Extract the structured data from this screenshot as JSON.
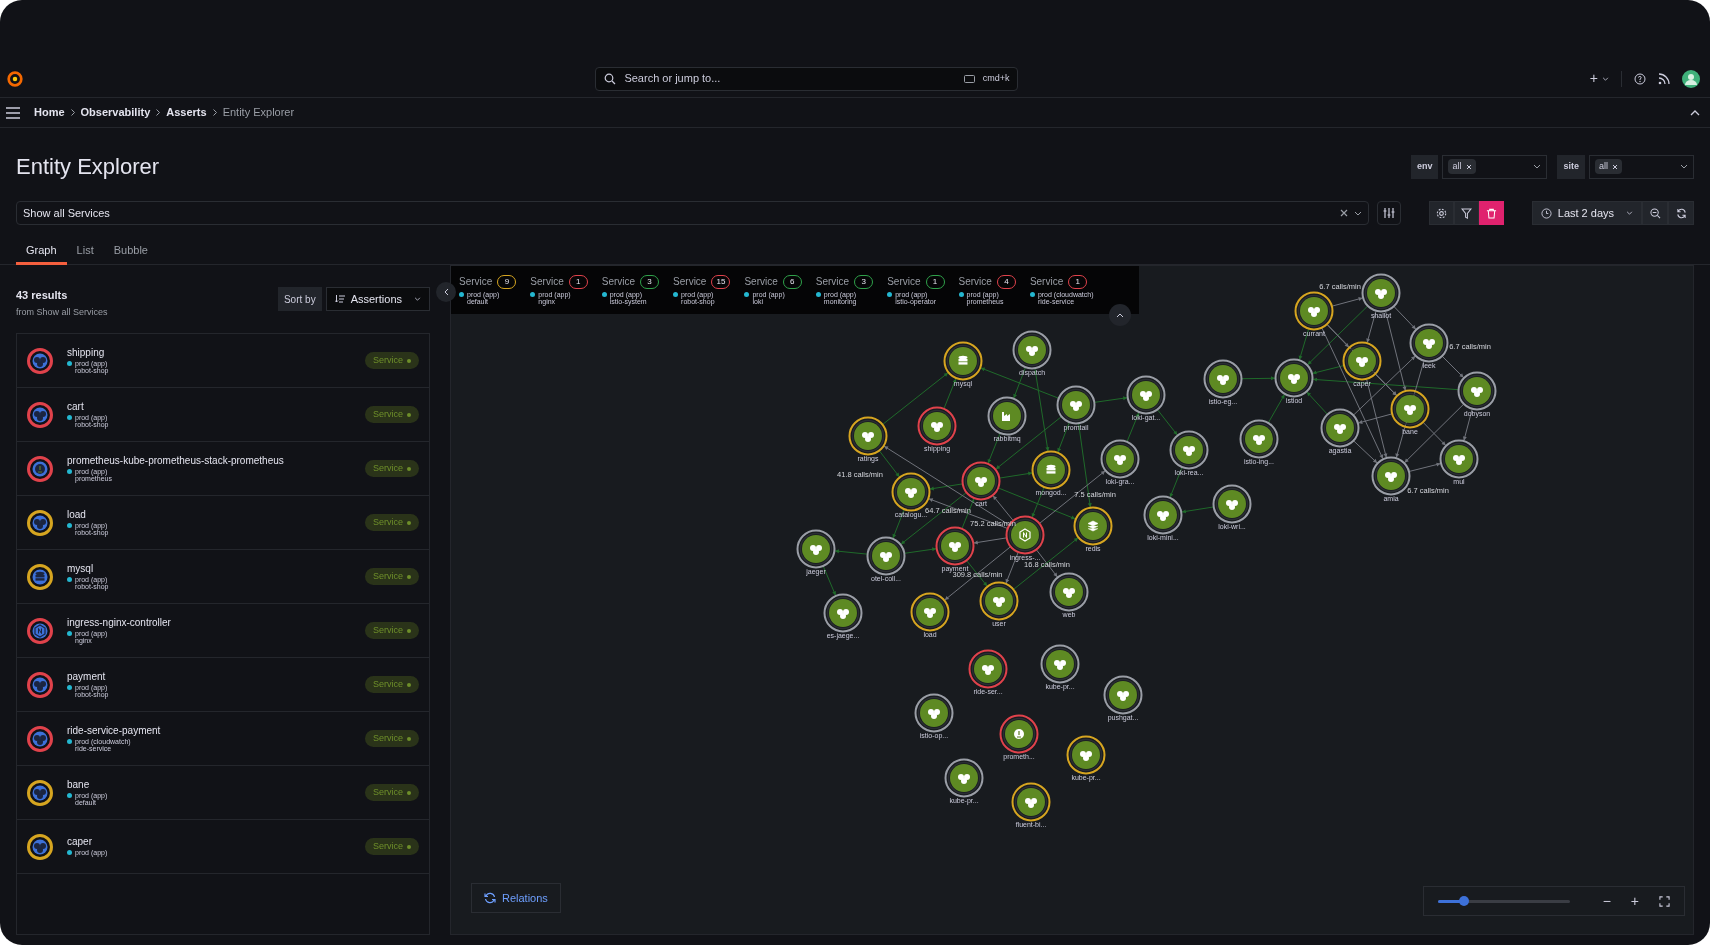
{
  "top_bar": {
    "search": {
      "placeholder": "Search or jump to...",
      "shortcut": "cmd+k"
    },
    "add_label": "+"
  },
  "breadcrumbs": [
    {
      "label": "Home",
      "current": false
    },
    {
      "label": "Observability",
      "current": false
    },
    {
      "label": "Asserts",
      "current": false
    },
    {
      "label": "Entity Explorer",
      "current": true
    }
  ],
  "page_title": "Entity Explorer",
  "variables": [
    {
      "label": "env",
      "value": "all"
    },
    {
      "label": "site",
      "value": "all"
    }
  ],
  "query": {
    "value": "Show all Services"
  },
  "time_range": "Last 2 days",
  "tabs": [
    {
      "label": "Graph",
      "selected": true
    },
    {
      "label": "List",
      "selected": false
    },
    {
      "label": "Bubble",
      "selected": false
    }
  ],
  "results": {
    "count": "43 results",
    "source": "from Show all Services",
    "sort_label": "Sort by",
    "sort_value": "Assertions"
  },
  "entities": [
    {
      "name": "shipping",
      "env": "prod (app)",
      "namespace": "robot-shop",
      "badge": "Service",
      "kind": "service",
      "color": "#e0424b"
    },
    {
      "name": "cart",
      "env": "prod (app)",
      "namespace": "robot-shop",
      "badge": "Service",
      "kind": "service",
      "color": "#e0424b"
    },
    {
      "name": "prometheus-kube-prometheus-stack-prometheus",
      "env": "prod (app)",
      "namespace": "prometheus",
      "badge": "Service",
      "kind": "prometheus",
      "color": "#e0424b"
    },
    {
      "name": "load",
      "env": "prod (app)",
      "namespace": "robot-shop",
      "badge": "Service",
      "kind": "service",
      "color": "#d6a520"
    },
    {
      "name": "mysql",
      "env": "prod (app)",
      "namespace": "robot-shop",
      "badge": "Service",
      "kind": "database",
      "color": "#d6a520"
    },
    {
      "name": "ingress-nginx-controller",
      "env": "prod (app)",
      "namespace": "nginx",
      "badge": "Service",
      "kind": "nginx",
      "color": "#e0424b"
    },
    {
      "name": "payment",
      "env": "prod (app)",
      "namespace": "robot-shop",
      "badge": "Service",
      "kind": "service",
      "color": "#e0424b"
    },
    {
      "name": "ride-service-payment",
      "env": "prod (cloudwatch)",
      "namespace": "ride-service",
      "badge": "Service",
      "kind": "service",
      "color": "#e0424b"
    },
    {
      "name": "bane",
      "env": "prod (app)",
      "namespace": "default",
      "badge": "Service",
      "kind": "service",
      "color": "#d6a520"
    },
    {
      "name": "caper",
      "env": "prod (app)",
      "badge": "Service",
      "kind": "service",
      "color": "#d6a520"
    }
  ],
  "summary": [
    {
      "label": "Service",
      "count": "9",
      "color": "#d6a520",
      "env": "prod (app)",
      "namespace": "default"
    },
    {
      "label": "Service",
      "count": "1",
      "color": "#e0424b",
      "env": "prod (app)",
      "namespace": "nginx"
    },
    {
      "label": "Service",
      "count": "3",
      "color": "#2fa14a",
      "env": "prod (app)",
      "namespace": "istio-system"
    },
    {
      "label": "Service",
      "count": "15",
      "color": "#e0424b",
      "env": "prod (app)",
      "namespace": "robot-shop"
    },
    {
      "label": "Service",
      "count": "6",
      "color": "#2fa14a",
      "env": "prod (app)",
      "namespace": "loki"
    },
    {
      "label": "Service",
      "count": "3",
      "color": "#2fa14a",
      "env": "prod (app)",
      "namespace": "monitoring"
    },
    {
      "label": "Service",
      "count": "1",
      "color": "#2fa14a",
      "env": "prod (app)",
      "namespace": "istio-operator"
    },
    {
      "label": "Service",
      "count": "4",
      "color": "#e0424b",
      "env": "prod (app)",
      "namespace": "prometheus"
    },
    {
      "label": "Service",
      "count": "1",
      "color": "#e0424b",
      "env": "prod (cloudwatch)",
      "namespace": "ride-service"
    }
  ],
  "graph": {
    "nodes": [
      {
        "label": "mysql",
        "kind": "database",
        "color": "#d6a520"
      },
      {
        "label": "dispatch",
        "kind": "service",
        "color": "#9a9ea6"
      },
      {
        "label": "rabbitmq",
        "kind": "factory",
        "color": "#9a9ea6"
      },
      {
        "label": "promtail",
        "kind": "service",
        "color": "#9a9ea6"
      },
      {
        "label": "loki-gat...",
        "kind": "service",
        "color": "#9a9ea6"
      },
      {
        "label": "shipping",
        "kind": "service",
        "color": "#e0424b"
      },
      {
        "label": "ratings",
        "kind": "service",
        "color": "#d6a520"
      },
      {
        "label": "cart",
        "kind": "service",
        "color": "#e0424b"
      },
      {
        "label": "mongod...",
        "kind": "database",
        "color": "#d6a520"
      },
      {
        "label": "loki-gra...",
        "kind": "service",
        "color": "#9a9ea6"
      },
      {
        "label": "loki-rea...",
        "kind": "service",
        "color": "#9a9ea6"
      },
      {
        "label": "catalogu...",
        "kind": "service",
        "color": "#d6a520"
      },
      {
        "label": "ingress-...",
        "kind": "nginx",
        "color": "#e0424b"
      },
      {
        "label": "redis",
        "kind": "layers",
        "color": "#d6a520"
      },
      {
        "label": "loki-mini...",
        "kind": "service",
        "color": "#9a9ea6"
      },
      {
        "label": "jaeger",
        "kind": "service",
        "color": "#9a9ea6"
      },
      {
        "label": "otel-coll...",
        "kind": "service",
        "color": "#9a9ea6"
      },
      {
        "label": "payment",
        "kind": "service",
        "color": "#e0424b"
      },
      {
        "label": "web",
        "kind": "service",
        "color": "#9a9ea6"
      },
      {
        "label": "user",
        "kind": "service",
        "color": "#d6a520"
      },
      {
        "label": "load",
        "kind": "service",
        "color": "#d6a520"
      },
      {
        "label": "es-jaege...",
        "kind": "service",
        "color": "#9a9ea6"
      },
      {
        "label": "istio-eg...",
        "kind": "service",
        "color": "#9a9ea6"
      },
      {
        "label": "istiod",
        "kind": "service",
        "color": "#9a9ea6"
      },
      {
        "label": "istio-ing...",
        "kind": "service",
        "color": "#9a9ea6"
      },
      {
        "label": "loki-wri...",
        "kind": "service",
        "color": "#9a9ea6"
      },
      {
        "label": "currant",
        "kind": "service",
        "color": "#d6a520"
      },
      {
        "label": "shallot",
        "kind": "service",
        "color": "#9a9ea6"
      },
      {
        "label": "leek",
        "kind": "service",
        "color": "#9a9ea6"
      },
      {
        "label": "caper",
        "kind": "service",
        "color": "#d6a520"
      },
      {
        "label": "dobyson",
        "kind": "service",
        "color": "#9a9ea6"
      },
      {
        "label": "bane",
        "kind": "service",
        "color": "#d6a520"
      },
      {
        "label": "agastia",
        "kind": "service",
        "color": "#9a9ea6"
      },
      {
        "label": "amia",
        "kind": "service",
        "color": "#9a9ea6"
      },
      {
        "label": "mul",
        "kind": "service",
        "color": "#9a9ea6"
      },
      {
        "label": "ride-ser...",
        "kind": "service",
        "color": "#e0424b"
      },
      {
        "label": "kube-pr...",
        "kind": "service",
        "color": "#9a9ea6"
      },
      {
        "label": "pushgat...",
        "kind": "service",
        "color": "#9a9ea6"
      },
      {
        "label": "istio-op...",
        "kind": "service",
        "color": "#9a9ea6"
      },
      {
        "label": "prometh...",
        "kind": "prometheus",
        "color": "#e0424b"
      },
      {
        "label": "kube-pr...",
        "kind": "service",
        "color": "#d6a520"
      },
      {
        "label": "kube-pr...",
        "kind": "service",
        "color": "#9a9ea6"
      },
      {
        "label": "fluent-bi...",
        "kind": "service",
        "color": "#d6a520"
      }
    ],
    "edges": [
      {
        "kind": "call"
      },
      {
        "kind": "call"
      },
      {
        "kind": "call"
      },
      {
        "kind": "call"
      },
      {
        "kind": "call"
      },
      {
        "kind": "call"
      },
      {
        "kind": "call"
      },
      {
        "kind": "call"
      },
      {
        "kind": "call"
      },
      {
        "kind": "call"
      },
      {
        "kind": "call"
      },
      {
        "kind": "call"
      },
      {
        "kind": "call"
      },
      {
        "kind": "call"
      },
      {
        "kind": "call"
      },
      {
        "kind": "call"
      },
      {
        "kind": "call"
      },
      {
        "kind": "call"
      },
      {
        "kind": "call"
      },
      {
        "kind": "call"
      },
      {
        "kind": "call"
      },
      {
        "kind": "traffic",
        "label": "41.8 calls/min"
      },
      {
        "kind": "traffic",
        "label": "64.7 calls/min"
      },
      {
        "kind": "traffic"
      },
      {
        "kind": "traffic",
        "label": "75.2 calls/min"
      },
      {
        "kind": "traffic",
        "label": "7.5 calls/min"
      },
      {
        "kind": "traffic",
        "label": "16.8 calls/min"
      },
      {
        "kind": "traffic",
        "label": "309.8 calls/min"
      },
      {
        "kind": "traffic"
      },
      {
        "kind": "call"
      },
      {
        "kind": "call"
      },
      {
        "kind": "call"
      },
      {
        "kind": "call"
      },
      {
        "kind": "call"
      },
      {
        "kind": "call"
      },
      {
        "kind": "call"
      },
      {
        "kind": "call"
      },
      {
        "kind": "call"
      },
      {
        "kind": "call"
      },
      {
        "kind": "call"
      },
      {
        "kind": "call"
      },
      {
        "kind": "call"
      },
      {
        "kind": "traffic",
        "label": "6.7 calls/min"
      },
      {
        "kind": "traffic"
      },
      {
        "kind": "traffic"
      },
      {
        "kind": "traffic"
      },
      {
        "kind": "traffic"
      },
      {
        "kind": "traffic",
        "label": "6.7 calls/min"
      },
      {
        "kind": "traffic"
      },
      {
        "kind": "traffic"
      },
      {
        "kind": "traffic"
      },
      {
        "kind": "traffic",
        "label": "6.7 calls/min"
      },
      {
        "kind": "traffic"
      },
      {
        "kind": "traffic"
      },
      {
        "kind": "traffic"
      },
      {
        "kind": "traffic"
      },
      {
        "kind": "traffic"
      },
      {
        "kind": "traffic"
      },
      {
        "kind": "traffic"
      },
      {
        "kind": "traffic"
      }
    ]
  },
  "relations_button": "Relations",
  "zoom": {
    "level": 0.2,
    "minus": "−",
    "plus": "+"
  }
}
